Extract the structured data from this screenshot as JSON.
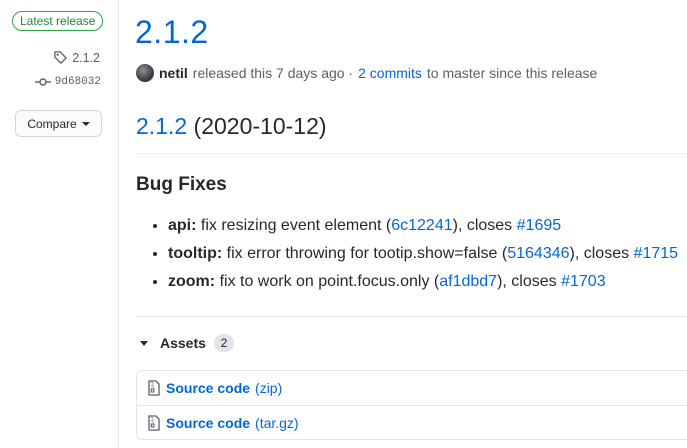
{
  "sidebar": {
    "badge": "Latest release",
    "tag": "2.1.2",
    "commit": "9d68032",
    "compare_label": "Compare"
  },
  "release": {
    "title": "2.1.2",
    "author": "netil",
    "released_text": "released this 7 days ago ·",
    "commits_link": "2 commits",
    "commits_suffix": "to master since this release",
    "heading_link": "2.1.2",
    "heading_date": "(2020-10-12)",
    "section_title": "Bug Fixes",
    "fixes": [
      {
        "scope": "api:",
        "text": "fix resizing event element (",
        "hash": "6c12241",
        "mid": "), closes",
        "issue": "#1695"
      },
      {
        "scope": "tooltip:",
        "text": "fix error throwing for tootip.show=false (",
        "hash": "5164346",
        "mid": "), closes",
        "issue": "#1715"
      },
      {
        "scope": "zoom:",
        "text": "fix to work on point.focus.only (",
        "hash": "af1dbd7",
        "mid": "), closes",
        "issue": "#1703"
      }
    ]
  },
  "assets": {
    "label": "Assets",
    "count": "2",
    "items": [
      {
        "name": "Source code",
        "ext": "(zip)"
      },
      {
        "name": "Source code",
        "ext": "(tar.gz)"
      }
    ]
  },
  "icons": [
    "tag-icon",
    "commit-icon",
    "caret-down-icon",
    "triangle-down-icon",
    "file-zip-icon"
  ],
  "colors": {
    "link": "#0366d6",
    "badge_green": "#28a745",
    "text": "#24292e",
    "muted": "#586069"
  }
}
